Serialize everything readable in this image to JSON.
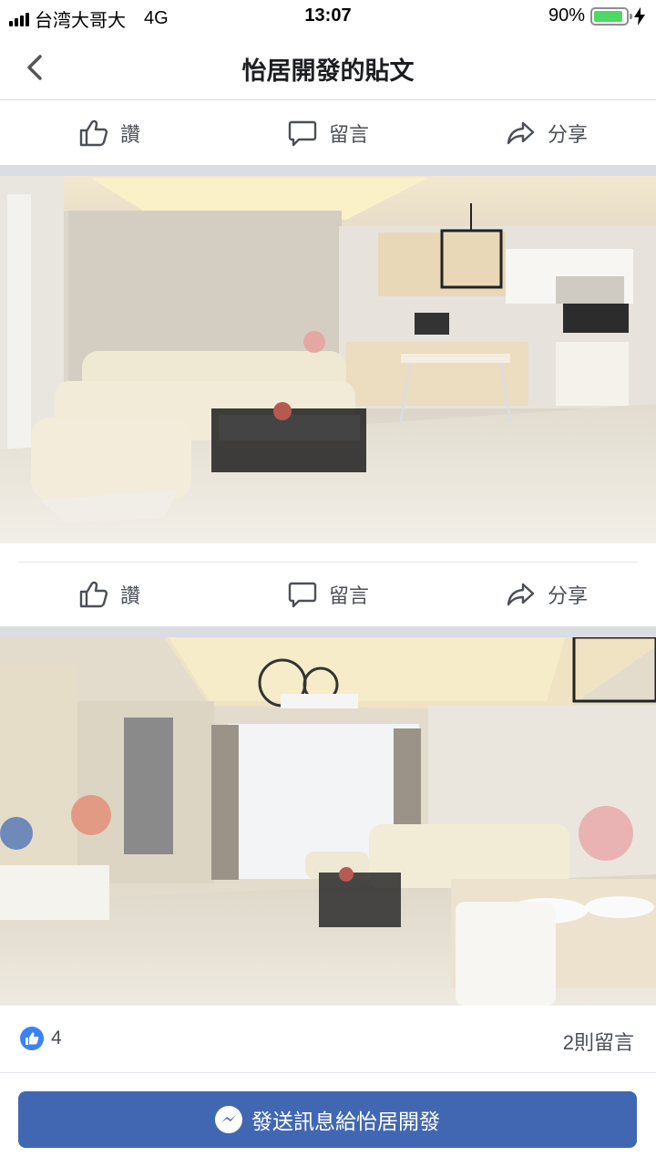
{
  "status_bar": {
    "carrier": "台湾大哥大",
    "network": "4G",
    "time": "13:07",
    "battery_percent": "90%",
    "battery_level": 0.9
  },
  "nav": {
    "back_icon": "chevron-left-icon",
    "title": "怡居開發的貼文"
  },
  "actions": {
    "like_label": "讚",
    "comment_label": "留言",
    "share_label": "分享"
  },
  "reactions": {
    "like_count": "4",
    "comment_count": "2則留言"
  },
  "message_button": {
    "label": "發送訊息給怡居開發",
    "color": "#4267b2"
  }
}
